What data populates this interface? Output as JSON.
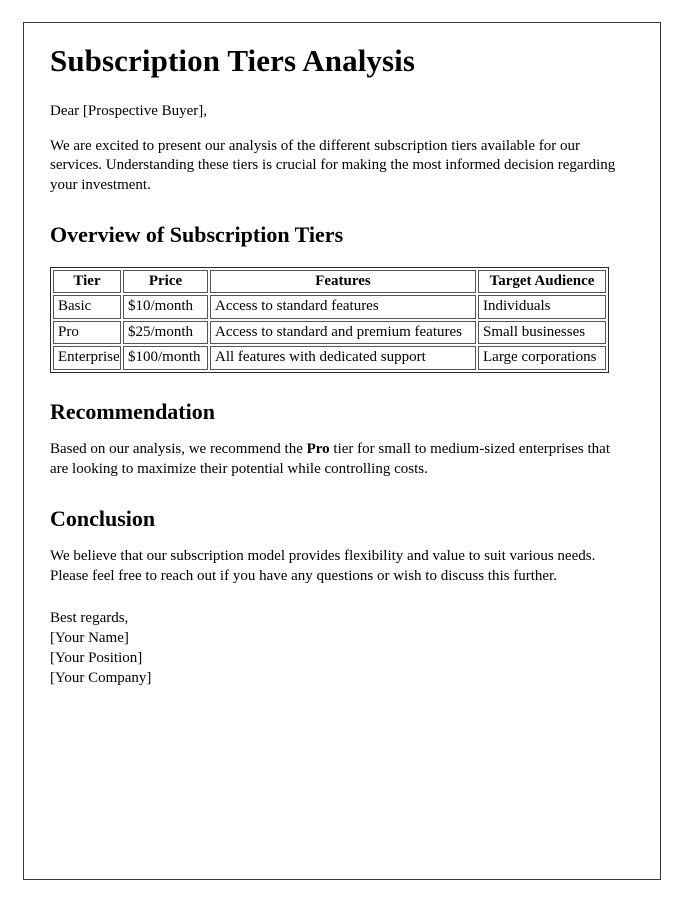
{
  "document": {
    "title": "Subscription Tiers Analysis",
    "salutation": "Dear [Prospective Buyer],",
    "intro_paragraph": "We are excited to present our analysis of the different subscription tiers available for our services. Understanding these tiers is crucial for making the most informed decision regarding your investment.",
    "sections": {
      "overview": {
        "heading": "Overview of Subscription Tiers"
      },
      "recommendation": {
        "heading": "Recommendation",
        "text_before_emphasis": "Based on our analysis, we recommend the ",
        "emphasized_term": "Pro",
        "text_after_emphasis": " tier for small to medium-sized enterprises that are looking to maximize their potential while controlling costs."
      },
      "conclusion": {
        "heading": "Conclusion",
        "paragraph": "We believe that our subscription model provides flexibility and value to suit various needs. Please feel free to reach out if you have any questions or wish to discuss this further."
      }
    },
    "signature": {
      "closing": "Best regards,",
      "name": "[Your Name]",
      "position": "[Your Position]",
      "company": "[Your Company]"
    }
  },
  "table": {
    "columns": [
      "Tier",
      "Price",
      "Features",
      "Target Audience"
    ],
    "rows": [
      {
        "tier": "Basic",
        "price": "$10/month",
        "features": "Access to standard features",
        "audience": "Individuals"
      },
      {
        "tier": "Pro",
        "price": "$25/month",
        "features": "Access to standard and premium features",
        "audience": "Small businesses"
      },
      {
        "tier": "Enterprise",
        "price": "$100/month",
        "features": "All features with dedicated support",
        "audience": "Large corporations"
      }
    ]
  },
  "theme": {
    "page_background": "#ffffff",
    "text_color": "#000000",
    "frame_border_color": "#3a3a3a",
    "table_border_color": "#2b2b2b",
    "cell_border_color": "#555555"
  }
}
